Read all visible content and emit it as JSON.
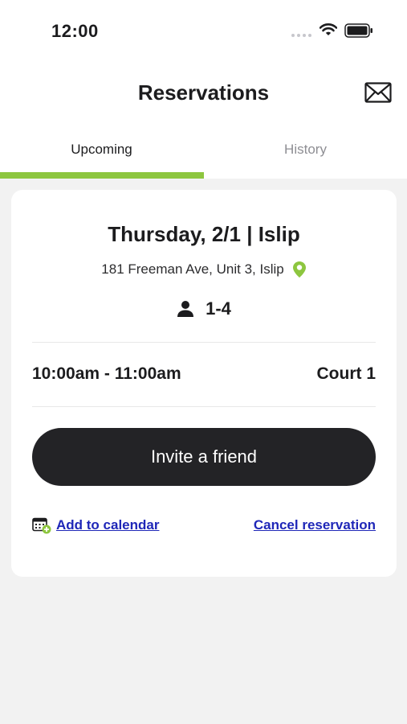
{
  "status_bar": {
    "time": "12:00"
  },
  "header": {
    "title": "Reservations",
    "mail_icon": "mail-icon"
  },
  "tabs": [
    {
      "label": "Upcoming",
      "active": true
    },
    {
      "label": "History",
      "active": false
    }
  ],
  "reservation": {
    "date_location": "Thursday, 2/1  |  Islip",
    "address": "181 Freeman Ave, Unit 3, Islip",
    "players": "1-4",
    "time_range": "10:00am - 11:00am",
    "court": "Court 1",
    "invite_label": "Invite a friend",
    "add_calendar_label": "Add to calendar",
    "cancel_label": "Cancel reservation"
  },
  "colors": {
    "accent": "#8dc63f",
    "button": "#232326",
    "link": "#1f27b8",
    "background": "#f2f2f2"
  }
}
